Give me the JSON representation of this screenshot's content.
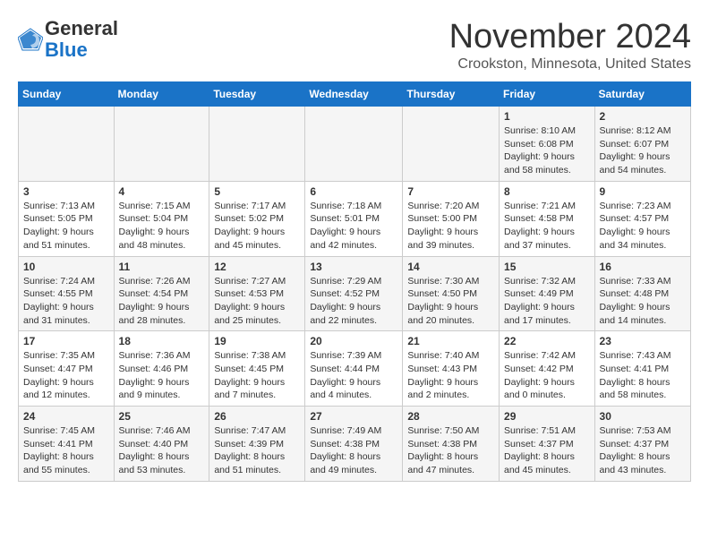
{
  "header": {
    "logo_line1": "General",
    "logo_line2": "Blue",
    "month_title": "November 2024",
    "location": "Crookston, Minnesota, United States"
  },
  "calendar": {
    "weekdays": [
      "Sunday",
      "Monday",
      "Tuesday",
      "Wednesday",
      "Thursday",
      "Friday",
      "Saturday"
    ],
    "weeks": [
      [
        {
          "day": "",
          "info": ""
        },
        {
          "day": "",
          "info": ""
        },
        {
          "day": "",
          "info": ""
        },
        {
          "day": "",
          "info": ""
        },
        {
          "day": "",
          "info": ""
        },
        {
          "day": "1",
          "info": "Sunrise: 8:10 AM\nSunset: 6:08 PM\nDaylight: 9 hours and 58 minutes."
        },
        {
          "day": "2",
          "info": "Sunrise: 8:12 AM\nSunset: 6:07 PM\nDaylight: 9 hours and 54 minutes."
        }
      ],
      [
        {
          "day": "3",
          "info": "Sunrise: 7:13 AM\nSunset: 5:05 PM\nDaylight: 9 hours and 51 minutes."
        },
        {
          "day": "4",
          "info": "Sunrise: 7:15 AM\nSunset: 5:04 PM\nDaylight: 9 hours and 48 minutes."
        },
        {
          "day": "5",
          "info": "Sunrise: 7:17 AM\nSunset: 5:02 PM\nDaylight: 9 hours and 45 minutes."
        },
        {
          "day": "6",
          "info": "Sunrise: 7:18 AM\nSunset: 5:01 PM\nDaylight: 9 hours and 42 minutes."
        },
        {
          "day": "7",
          "info": "Sunrise: 7:20 AM\nSunset: 5:00 PM\nDaylight: 9 hours and 39 minutes."
        },
        {
          "day": "8",
          "info": "Sunrise: 7:21 AM\nSunset: 4:58 PM\nDaylight: 9 hours and 37 minutes."
        },
        {
          "day": "9",
          "info": "Sunrise: 7:23 AM\nSunset: 4:57 PM\nDaylight: 9 hours and 34 minutes."
        }
      ],
      [
        {
          "day": "10",
          "info": "Sunrise: 7:24 AM\nSunset: 4:55 PM\nDaylight: 9 hours and 31 minutes."
        },
        {
          "day": "11",
          "info": "Sunrise: 7:26 AM\nSunset: 4:54 PM\nDaylight: 9 hours and 28 minutes."
        },
        {
          "day": "12",
          "info": "Sunrise: 7:27 AM\nSunset: 4:53 PM\nDaylight: 9 hours and 25 minutes."
        },
        {
          "day": "13",
          "info": "Sunrise: 7:29 AM\nSunset: 4:52 PM\nDaylight: 9 hours and 22 minutes."
        },
        {
          "day": "14",
          "info": "Sunrise: 7:30 AM\nSunset: 4:50 PM\nDaylight: 9 hours and 20 minutes."
        },
        {
          "day": "15",
          "info": "Sunrise: 7:32 AM\nSunset: 4:49 PM\nDaylight: 9 hours and 17 minutes."
        },
        {
          "day": "16",
          "info": "Sunrise: 7:33 AM\nSunset: 4:48 PM\nDaylight: 9 hours and 14 minutes."
        }
      ],
      [
        {
          "day": "17",
          "info": "Sunrise: 7:35 AM\nSunset: 4:47 PM\nDaylight: 9 hours and 12 minutes."
        },
        {
          "day": "18",
          "info": "Sunrise: 7:36 AM\nSunset: 4:46 PM\nDaylight: 9 hours and 9 minutes."
        },
        {
          "day": "19",
          "info": "Sunrise: 7:38 AM\nSunset: 4:45 PM\nDaylight: 9 hours and 7 minutes."
        },
        {
          "day": "20",
          "info": "Sunrise: 7:39 AM\nSunset: 4:44 PM\nDaylight: 9 hours and 4 minutes."
        },
        {
          "day": "21",
          "info": "Sunrise: 7:40 AM\nSunset: 4:43 PM\nDaylight: 9 hours and 2 minutes."
        },
        {
          "day": "22",
          "info": "Sunrise: 7:42 AM\nSunset: 4:42 PM\nDaylight: 9 hours and 0 minutes."
        },
        {
          "day": "23",
          "info": "Sunrise: 7:43 AM\nSunset: 4:41 PM\nDaylight: 8 hours and 58 minutes."
        }
      ],
      [
        {
          "day": "24",
          "info": "Sunrise: 7:45 AM\nSunset: 4:41 PM\nDaylight: 8 hours and 55 minutes."
        },
        {
          "day": "25",
          "info": "Sunrise: 7:46 AM\nSunset: 4:40 PM\nDaylight: 8 hours and 53 minutes."
        },
        {
          "day": "26",
          "info": "Sunrise: 7:47 AM\nSunset: 4:39 PM\nDaylight: 8 hours and 51 minutes."
        },
        {
          "day": "27",
          "info": "Sunrise: 7:49 AM\nSunset: 4:38 PM\nDaylight: 8 hours and 49 minutes."
        },
        {
          "day": "28",
          "info": "Sunrise: 7:50 AM\nSunset: 4:38 PM\nDaylight: 8 hours and 47 minutes."
        },
        {
          "day": "29",
          "info": "Sunrise: 7:51 AM\nSunset: 4:37 PM\nDaylight: 8 hours and 45 minutes."
        },
        {
          "day": "30",
          "info": "Sunrise: 7:53 AM\nSunset: 4:37 PM\nDaylight: 8 hours and 43 minutes."
        }
      ]
    ]
  }
}
